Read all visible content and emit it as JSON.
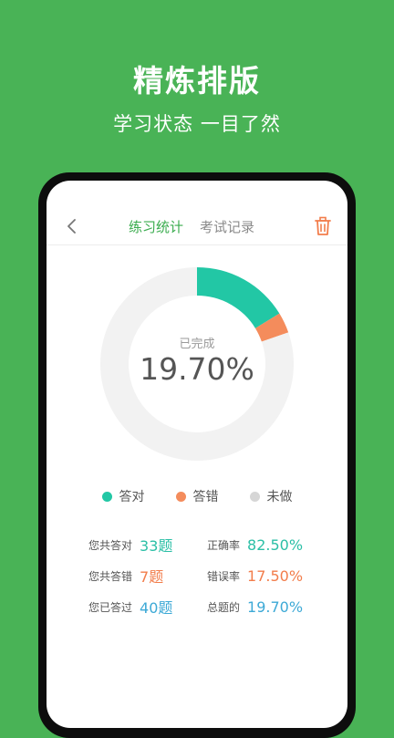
{
  "promo": {
    "title": "精炼排版",
    "subtitle": "学习状态 一目了然"
  },
  "header": {
    "tabs": [
      {
        "label": "练习统计",
        "active": true
      },
      {
        "label": "考试记录",
        "active": false
      }
    ]
  },
  "chart_data": {
    "type": "pie",
    "style": "donut",
    "center_label": "已完成",
    "center_value": "19.70%",
    "series": [
      {
        "name": "答对",
        "value": 16.25,
        "color": "#22c7a5"
      },
      {
        "name": "答错",
        "value": 3.45,
        "color": "#f48c5c"
      },
      {
        "name": "未做",
        "value": 80.3,
        "color": "#f2f2f2"
      }
    ],
    "legend_position": "bottom",
    "legend_dot_colors": [
      "#22c7a5",
      "#f48c5c",
      "#d6d6d6"
    ]
  },
  "stats": {
    "rows": [
      {
        "left_label": "您共答对",
        "left_value": "33题",
        "right_label": "正确率",
        "right_value": "82.50%"
      },
      {
        "left_label": "您共答错",
        "left_value": "7题",
        "right_label": "错误率",
        "right_value": "17.50%"
      },
      {
        "left_label": "您已答过",
        "left_value": "40题",
        "right_label": "总题的",
        "right_value": "19.70%"
      }
    ]
  },
  "colors": {
    "background": "#49b356",
    "accent": "#3aac4e",
    "trash": "#f27d4b"
  },
  "icons": {
    "back": "chevron-left-icon",
    "trash": "trash-icon"
  }
}
